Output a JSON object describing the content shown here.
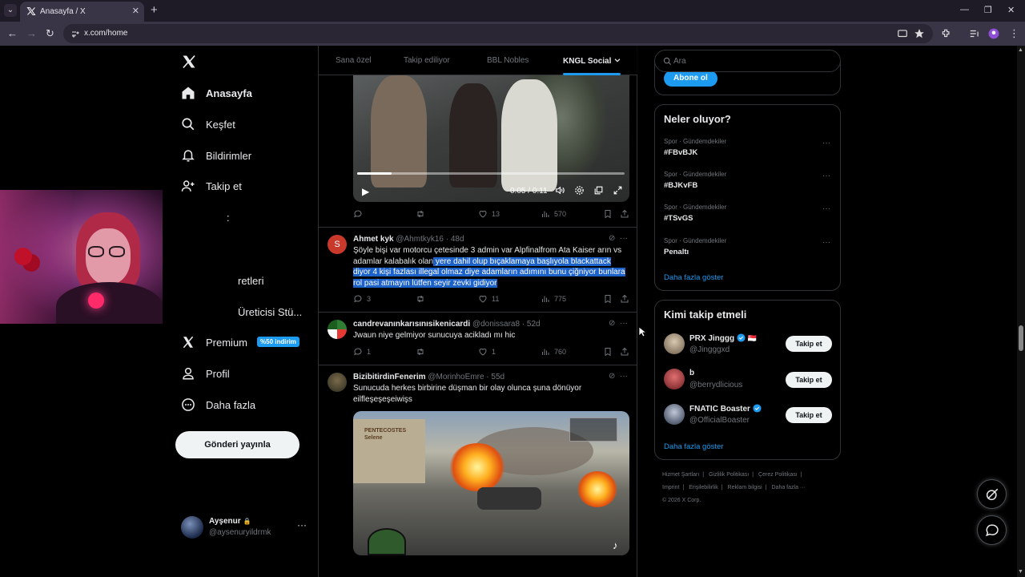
{
  "browser": {
    "tab_title": "Anasayfa / X",
    "url": "x.com/home"
  },
  "left_nav": {
    "items": [
      {
        "label": "Anasayfa",
        "icon": "home-icon"
      },
      {
        "label": "Keşfet",
        "icon": "search-icon"
      },
      {
        "label": "Bildirimler",
        "icon": "bell-icon"
      },
      {
        "label": "Takip et",
        "icon": "follow-icon"
      },
      {
        "label": ":",
        "icon": ""
      },
      {
        "label": "retleri",
        "icon": ""
      },
      {
        "label": "Üreticisi Stü...",
        "icon": ""
      },
      {
        "label": "Premium",
        "icon": "x-icon",
        "badge": "%50 indirim"
      },
      {
        "label": "Profil",
        "icon": "person-icon"
      },
      {
        "label": "Daha fazla",
        "icon": "more-circle-icon"
      }
    ],
    "post_button": "Gönderi yayınla",
    "account": {
      "name": "Ayşenur",
      "lock": "🔒",
      "handle": "@aysenuryildrmk",
      "more": "···"
    }
  },
  "home_tabs": [
    "Sana özel",
    "Takip ediliyor",
    "BBL Nobles",
    "KNGL Social"
  ],
  "feed": {
    "video1": {
      "time": "0:05 / 0:11",
      "progress": 0.13,
      "actions": {
        "replies": "",
        "reposts": "",
        "likes": "13",
        "views": "570"
      }
    },
    "tweet1": {
      "avatar_letter": "S",
      "name": "Ahmet kyk",
      "handle": "@Ahmtkyk16",
      "time": "· 48d",
      "text_plain": "Şöyle bişi var motorcu çetesinde 3 admin var Alpfinalfrom Ata  Kaiser arın vs adamlar kalabalık olan",
      "text_highlight": " yere dahil olup bıçaklamaya başlıyola blackattack diyor 4 kişi fazlası illegal olmaz diye adamların adımını bunu çiğniyor bunlara rol pasi atmayın lütfen seyir zevki gidiyor",
      "actions": {
        "replies": "3",
        "reposts": "",
        "likes": "11",
        "views": "775"
      }
    },
    "tweet2": {
      "name": "candrevanınkarısınısikenicardi",
      "handle": "@donissara8",
      "time": "· 52d",
      "text": "Jwaun niye gelmiyor sunucuya acikladı mı hic",
      "actions": {
        "replies": "1",
        "reposts": "",
        "likes": "1",
        "views": "760"
      }
    },
    "tweet3": {
      "name": "BizibitirdinFenerim",
      "handle": "@MorinhoEmre",
      "time": "· 55d",
      "text_line1": "Sunucuda herkes birbirine düşman bir olay olunca şuna dönüyor",
      "text_line2": "eilfleşeşeşeiwişs",
      "video_sign": "PENTECOSTES\nSelene"
    }
  },
  "right": {
    "search_placeholder": "Ara",
    "subscribe_label": "Abone ol",
    "trends": {
      "title": "Neler oluyor?",
      "items": [
        {
          "category": "Spor · Gündemdekiler",
          "name": "#FBvBJK"
        },
        {
          "category": "Spor · Gündemdekiler",
          "name": "#BJKvFB"
        },
        {
          "category": "Spor · Gündemdekiler",
          "name": "#TSvGS"
        },
        {
          "category": "Spor · Gündemdekiler",
          "name": "Penaltı"
        }
      ],
      "show_more": "Daha fazla göster"
    },
    "who_to_follow": {
      "title": "Kimi takip etmeli",
      "items": [
        {
          "name": "PRX Jinggg",
          "handle": "@Jingggxd",
          "verified": true,
          "flag": "🇸🇬"
        },
        {
          "name": "b",
          "handle": "@berrydlicious",
          "verified": false,
          "flag": ""
        },
        {
          "name": "FNATIC Boaster",
          "handle": "@OfficialBoaster",
          "verified": true,
          "flag": ""
        }
      ],
      "follow_label": "Takip et",
      "show_more": "Daha fazla göster"
    },
    "footer": {
      "links1": [
        "Hizmet Şartları",
        "Gizlilik Politikası",
        "Çerez Politikası"
      ],
      "links2": [
        "Imprint",
        "Erişilebilirlik",
        "Reklam bilgisi",
        "Daha fazla ···"
      ],
      "copyright": "© 2026 X Corp."
    }
  },
  "colors": {
    "accent": "#1d9bf0",
    "background": "#000000",
    "highlight": "#1d62c9"
  }
}
